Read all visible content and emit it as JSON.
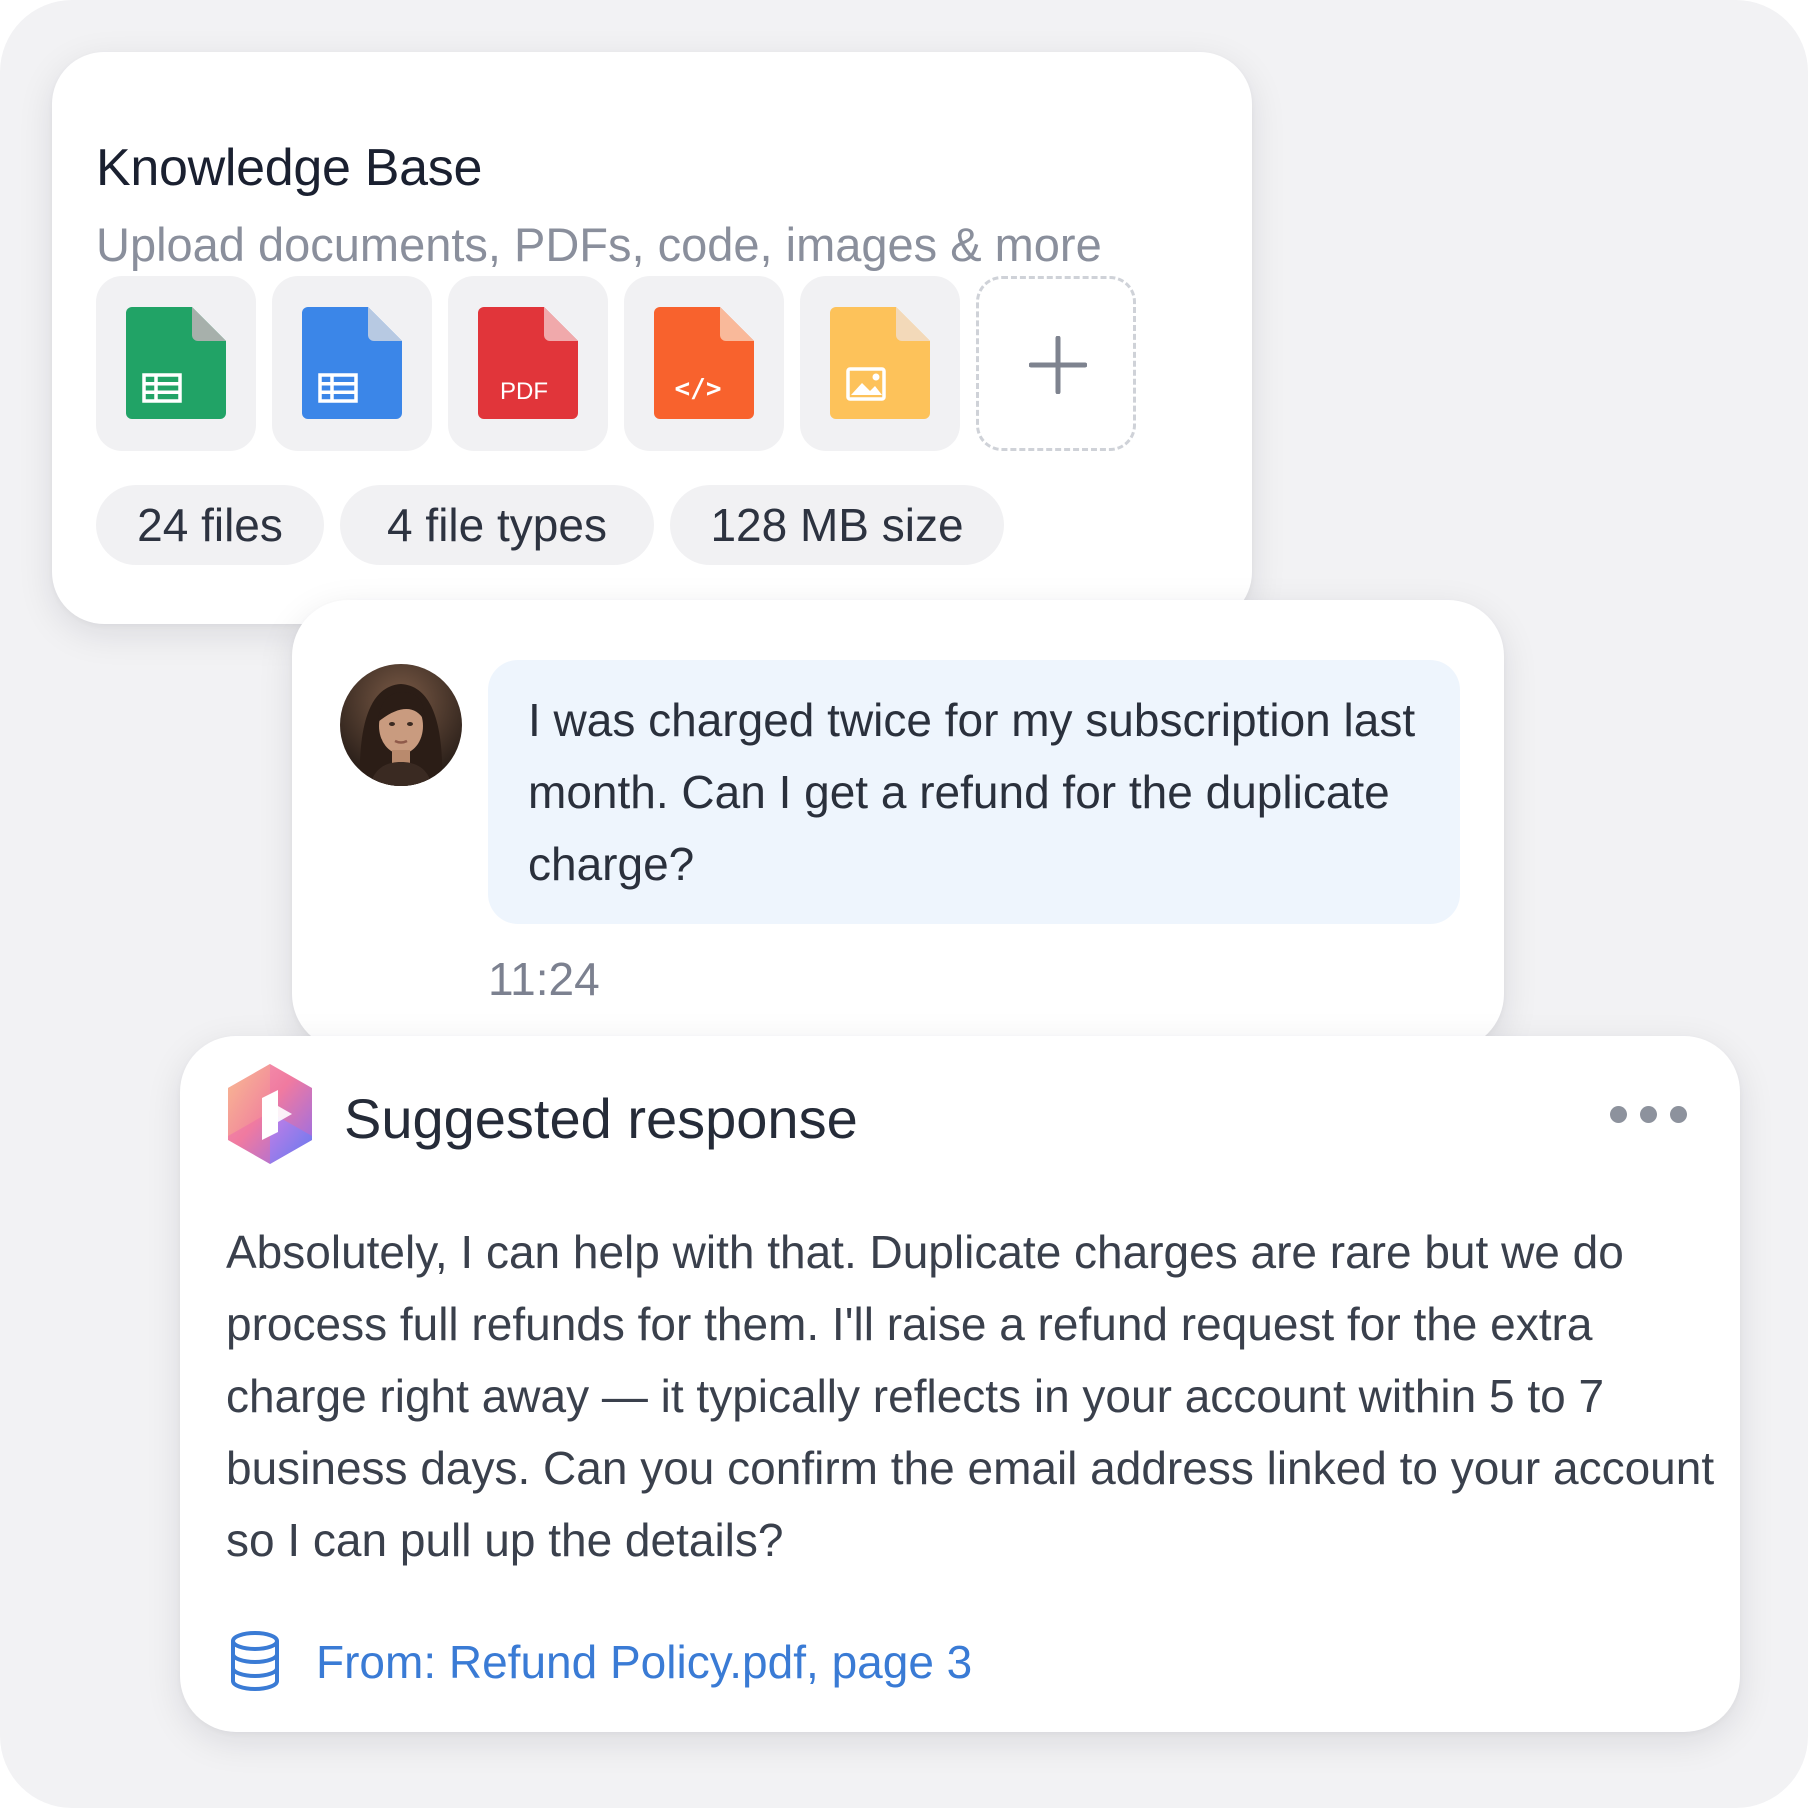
{
  "knowledge_base": {
    "title": "Knowledge Base",
    "subtitle": "Upload documents, PDFs, code, images & more",
    "file_tiles": [
      {
        "icon": "spreadsheet-file-icon",
        "color": "#21a366"
      },
      {
        "icon": "document-file-icon",
        "color": "#3b86e8"
      },
      {
        "icon": "pdf-file-icon",
        "color": "#e1353a",
        "label": "PDF"
      },
      {
        "icon": "code-file-icon",
        "color": "#f8622d",
        "label": "</>"
      },
      {
        "icon": "image-file-icon",
        "color": "#fdc25a"
      }
    ],
    "add_icon": "plus-icon",
    "stats": [
      "24 files",
      "4 file types",
      "128 MB size"
    ]
  },
  "chat": {
    "message": "I was charged twice for my subscription last month. Can I get a refund for the duplicate charge?",
    "time": "11:24"
  },
  "suggested_response": {
    "title": "Suggested response",
    "body": "Absolutely, I can help with that. Duplicate charges are rare but we do process full refunds for them. I'll raise a refund request for the extra charge right away — it typically reflects in your account within 5 to 7 business days. Can you confirm the email address linked to your account so I can pull up the details?",
    "source": "From: Refund Policy.pdf, page 3",
    "source_icon": "database-icon",
    "more_icon": "more-horizontal-icon",
    "source_color": "#3a7bd5"
  }
}
